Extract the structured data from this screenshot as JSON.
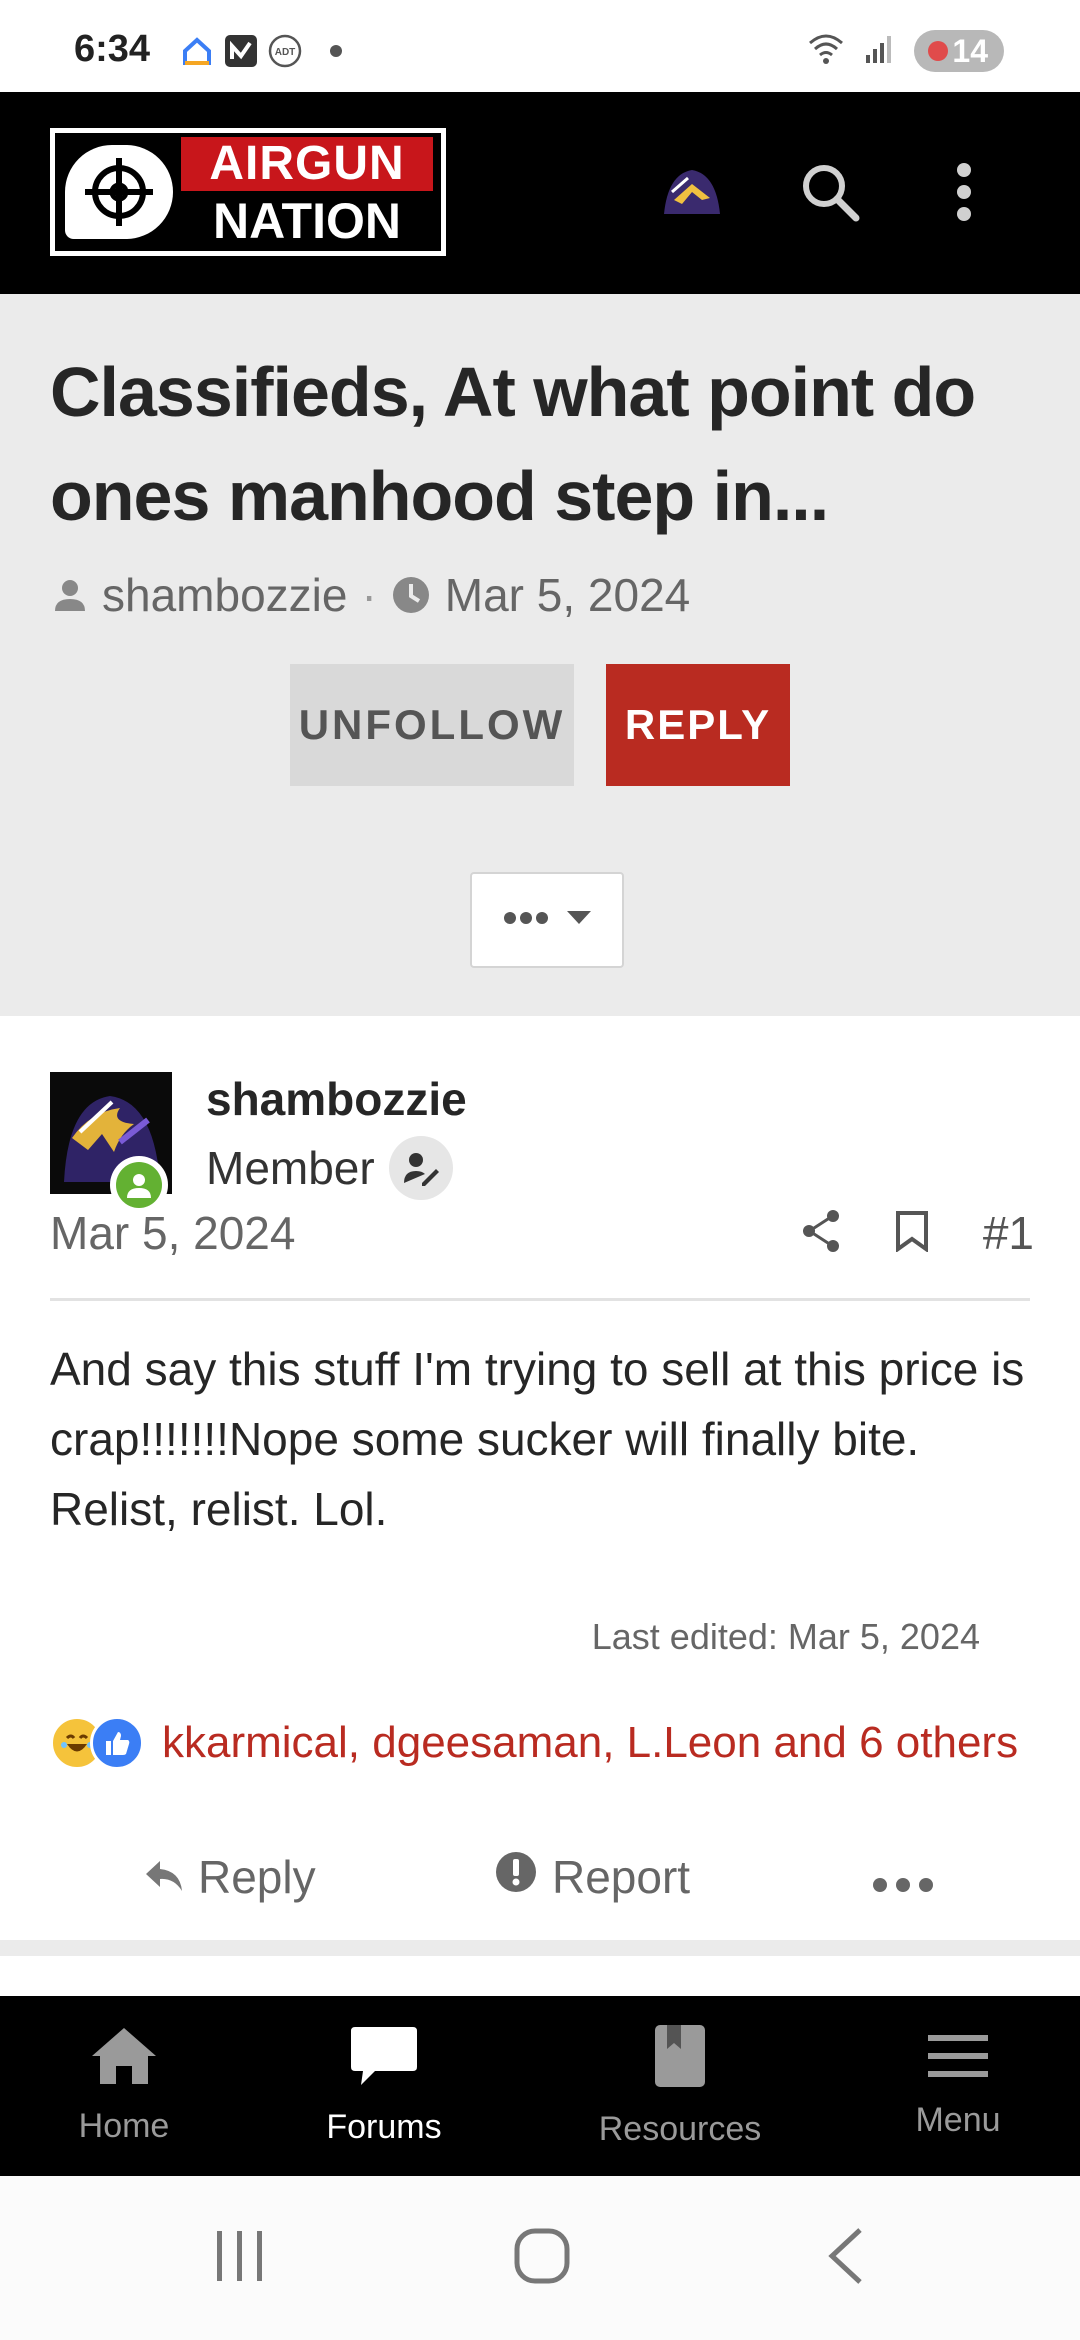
{
  "status_bar": {
    "time": "6:34",
    "battery": "14",
    "icons": [
      "home-alert-icon",
      "app-n-icon",
      "adt-icon",
      "dot-icon",
      "wifi-icon",
      "signal-icon"
    ]
  },
  "header": {
    "logo_line1": "AIRGUN",
    "logo_line2": "NATION",
    "brand_red": "#c8161b"
  },
  "thread": {
    "title": "Classifieds, At what point do ones manhood step in...",
    "author": "shambozzie",
    "date": "Mar 5, 2024",
    "unfollow_label": "UNFOLLOW",
    "reply_label": "REPLY"
  },
  "post": {
    "username": "shambozzie",
    "role": "Member",
    "date": "Mar 5, 2024",
    "number": "#1",
    "body": "And say this stuff I'm trying to sell at this price is crap!!!!!!!Nope some sucker will finally bite. Relist, relist. Lol.",
    "last_edited": "Last edited: Mar 5, 2024",
    "reaction_users": "kkarmical, dgeesaman, L.Leon and 6 others",
    "reply_label": "Reply",
    "report_label": "Report"
  },
  "bottom_nav": {
    "items": [
      {
        "label": "Home",
        "icon": "home-icon"
      },
      {
        "label": "Forums",
        "icon": "chat-bubble-icon",
        "active": true
      },
      {
        "label": "Resources",
        "icon": "book-icon"
      },
      {
        "label": "Menu",
        "icon": "hamburger-icon"
      }
    ]
  },
  "colors": {
    "accent_red": "#b92b21",
    "header_bg": "#000000",
    "thread_bg": "#ebebeb",
    "online_green": "#63b132"
  }
}
